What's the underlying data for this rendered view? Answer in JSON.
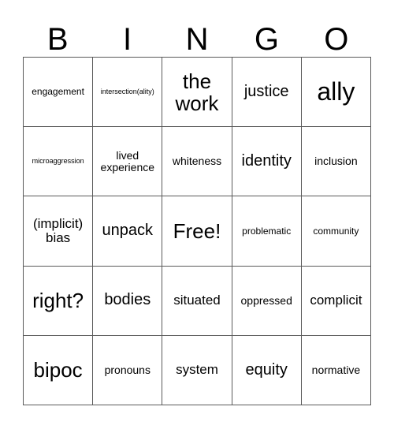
{
  "card": {
    "title": "BINGO",
    "header_letters": [
      "B",
      "I",
      "N",
      "G",
      "O"
    ],
    "free_space_label": "Free!",
    "grid_line_color": "#5a5a5a",
    "text_color": "#000000",
    "background_color": "#ffffff",
    "rows": 5,
    "columns": 5,
    "cells": [
      [
        {
          "label": "engagement",
          "size": "s"
        },
        {
          "label": "intersection(ality)",
          "size": "xs"
        },
        {
          "label": "the work",
          "size": "xxl"
        },
        {
          "label": "justice",
          "size": "xl"
        },
        {
          "label": "ally",
          "size": "h"
        }
      ],
      [
        {
          "label": "microaggression",
          "size": "xs"
        },
        {
          "label": "lived experience",
          "size": "m"
        },
        {
          "label": "whiteness",
          "size": "m"
        },
        {
          "label": "identity",
          "size": "xl"
        },
        {
          "label": "inclusion",
          "size": "m"
        }
      ],
      [
        {
          "label": "(implicit) bias",
          "size": "l"
        },
        {
          "label": "unpack",
          "size": "xl"
        },
        {
          "label": "Free!",
          "size": "xxl"
        },
        {
          "label": "problematic",
          "size": "s"
        },
        {
          "label": "community",
          "size": "s"
        }
      ],
      [
        {
          "label": "right?",
          "size": "xxl"
        },
        {
          "label": "bodies",
          "size": "xl"
        },
        {
          "label": "situated",
          "size": "l"
        },
        {
          "label": "oppressed",
          "size": "m"
        },
        {
          "label": "complicit",
          "size": "l"
        }
      ],
      [
        {
          "label": "bipoc",
          "size": "xxl"
        },
        {
          "label": "pronouns",
          "size": "m"
        },
        {
          "label": "system",
          "size": "l"
        },
        {
          "label": "equity",
          "size": "xl"
        },
        {
          "label": "normative",
          "size": "m"
        }
      ]
    ]
  }
}
